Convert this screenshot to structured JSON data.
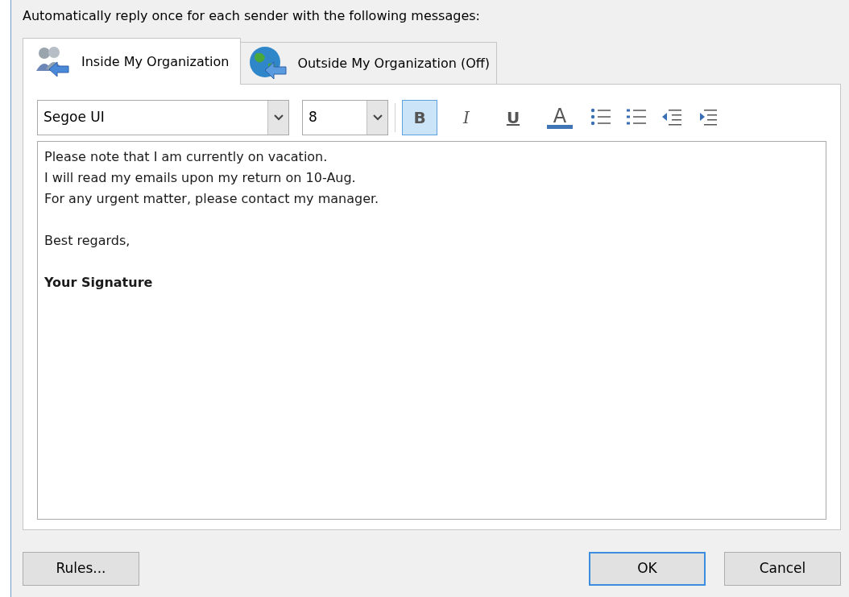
{
  "header": "Automatically reply once for each sender with the following messages:",
  "tabs": [
    {
      "label": "Inside My Organization",
      "kind": "people",
      "selected": true
    },
    {
      "label": "Outside My Organization (Off)",
      "kind": "globe",
      "selected": false
    }
  ],
  "toolbar": {
    "font": "Segoe UI",
    "size": "8",
    "buttons": [
      {
        "kind": "bold",
        "label": "B",
        "selected": true
      },
      {
        "kind": "italic",
        "label": "I",
        "selected": false
      },
      {
        "kind": "underline",
        "label": "U",
        "selected": false
      },
      {
        "kind": "font_color",
        "label": "A",
        "color": "#3f74b5"
      },
      {
        "kind": "bullets"
      },
      {
        "kind": "numbering"
      },
      {
        "kind": "outdent"
      },
      {
        "kind": "indent"
      }
    ]
  },
  "message": [
    {
      "bold": false,
      "lines": [
        "Please note that I am currently on vacation.",
        "I will read my emails upon my return on 10-Aug.",
        "For any urgent matter, please contact my manager."
      ]
    },
    {
      "bold": false,
      "lines": [
        "Best regards,"
      ]
    },
    {
      "bold": true,
      "lines": [
        "Your Signature"
      ]
    }
  ],
  "buttons": [
    {
      "label": "Rules...",
      "default": false
    },
    {
      "label": "OK",
      "default": true
    },
    {
      "label": "Cancel",
      "default": false
    }
  ]
}
